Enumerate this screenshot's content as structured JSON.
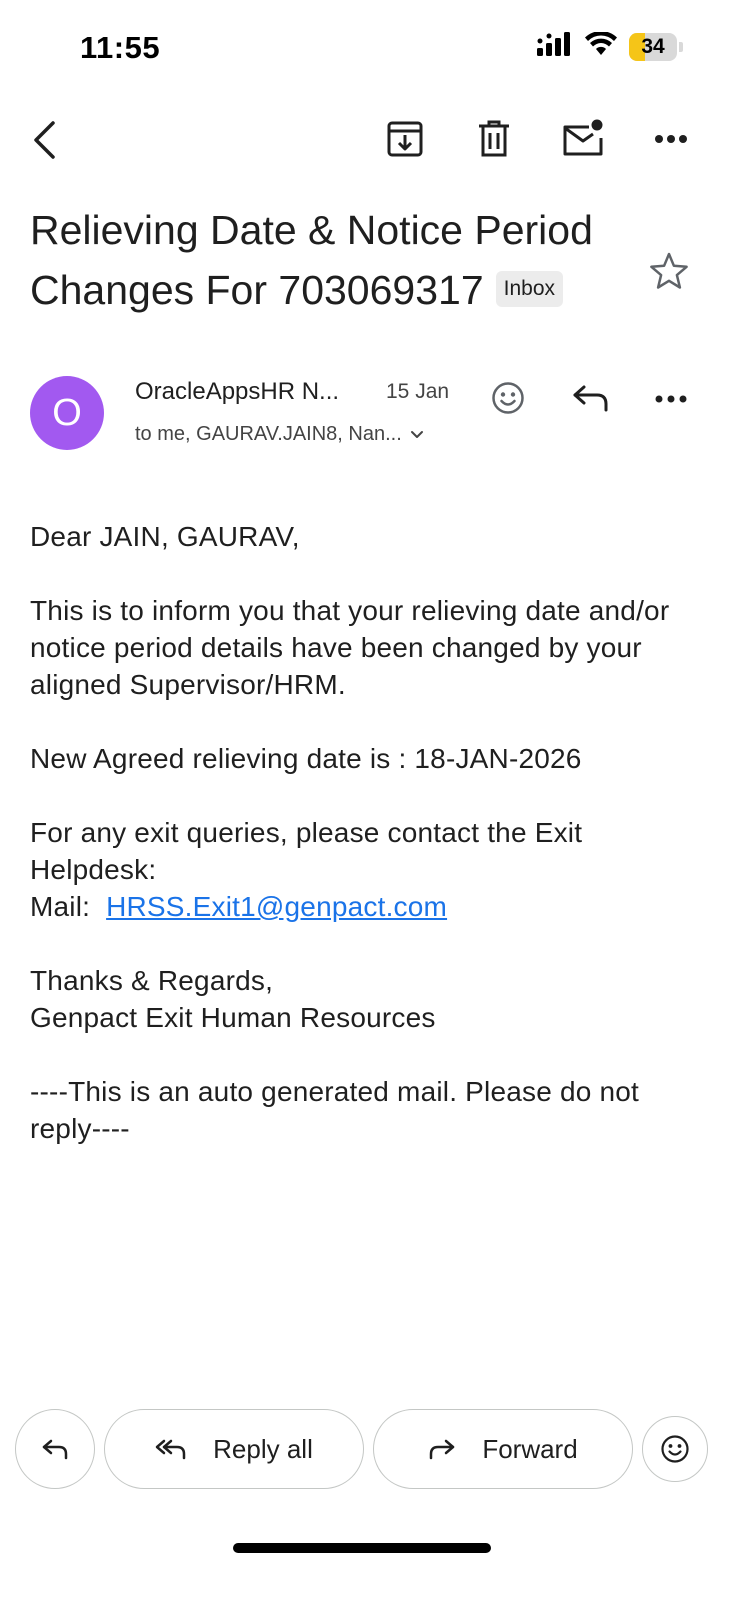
{
  "status_bar": {
    "time": "11:55",
    "battery": "34"
  },
  "email": {
    "subject": "Relieving Date & Notice Period Changes For 703069317",
    "label": "Inbox",
    "sender": {
      "initial": "O",
      "name": "OracleAppsHR N...",
      "date": "15 Jan",
      "recipients": "to me, GAURAV.JAIN8, Nan..."
    },
    "body": {
      "greeting": "Dear JAIN, GAURAV,",
      "paragraph1": "This is to inform you that your relieving date and/or notice period details have been changed by your aligned Supervisor/HRM.",
      "relieving_date_line": "New Agreed relieving date is : 18-JAN-2026",
      "contact_line": "For any exit queries, please contact the Exit Helpdesk:",
      "mail_label": "Mail:",
      "mail_link": "HRSS.Exit1@genpact.com",
      "sign_off": "Thanks & Regards,",
      "signature": "Genpact Exit Human Resources",
      "footer_note": "----This is an auto generated mail. Please do not reply----"
    }
  },
  "actions": {
    "reply_all": "Reply all",
    "forward": "Forward"
  },
  "colors": {
    "avatar": "#a259f0",
    "link": "#1a73e8",
    "battery": "#f5c518"
  }
}
